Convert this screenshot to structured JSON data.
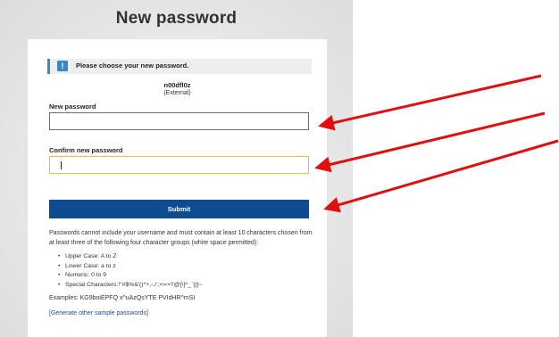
{
  "page": {
    "title": "New password"
  },
  "info": {
    "message": "Please choose your new password.",
    "icon": "info-icon"
  },
  "user": {
    "name": "n00dfl0z",
    "domain": "(External)"
  },
  "form": {
    "new_password_label": "New password",
    "new_password_value": "",
    "confirm_password_label": "Confirm new password",
    "confirm_password_value": "",
    "submit_label": "Submit"
  },
  "policy": {
    "text": "Passwords cannot include your username and must contain at least 10 characters chosen from at least three of the following four character groups (white space permitted):",
    "rules": [
      "Upper Case: A to Z",
      "Lower Case: a to z",
      "Numeric: 0 to 9",
      "Special Characters:!\"#$%&'()*+,-./:;<=>?@[\\]^_`{|}~"
    ],
    "examples": "Examples: KG9boiEPFQ x^uAzQsYTE PVIdHR^mSI",
    "generate_link": "[Generate other sample passwords]"
  },
  "colors": {
    "accent": "#0e4c92",
    "info": "#3a87c8",
    "focus_border": "#f0c030",
    "annotation_arrow": "#e01010"
  }
}
